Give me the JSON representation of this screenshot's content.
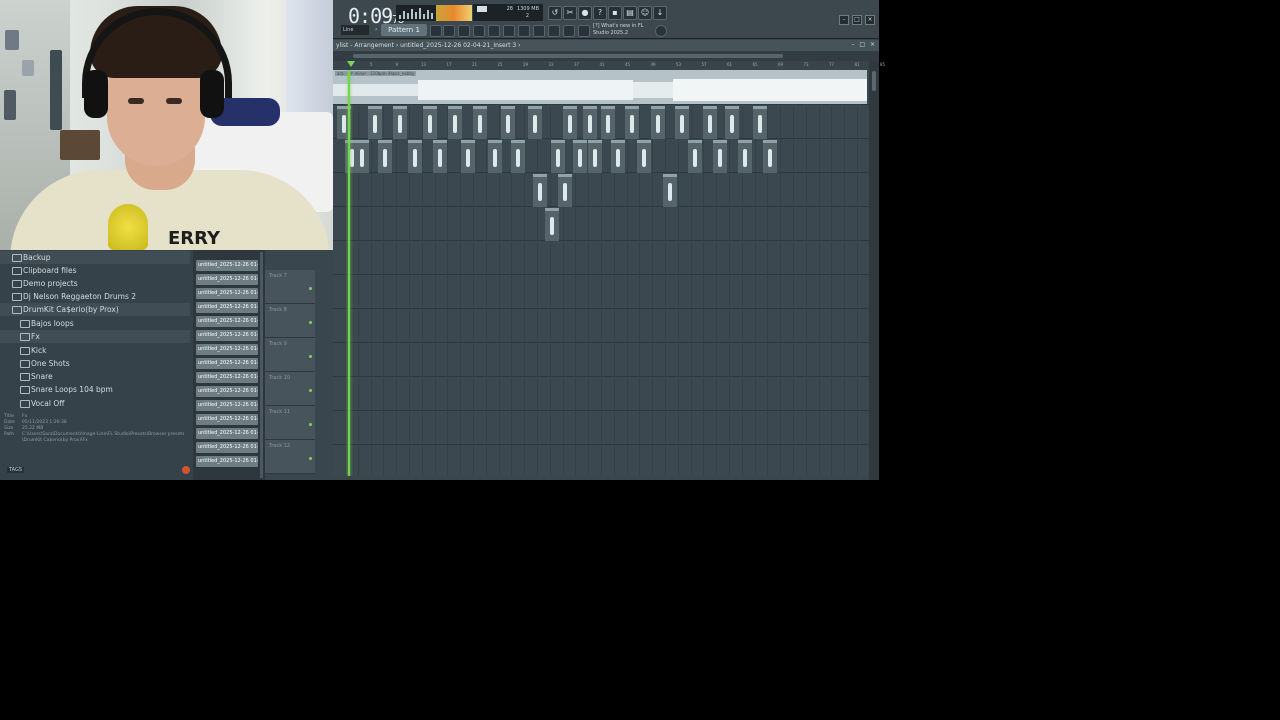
{
  "transport": {
    "time_main": "0:09",
    "time_sub": "78",
    "memory": "1309 MB",
    "cpu": "28",
    "cpu_sub": "2"
  },
  "toolbar": {
    "line_mode": "Line",
    "pattern": "Pattern 1",
    "whats_new_1": "[?] What's new in FL",
    "whats_new_2": "Studio 2025.2"
  },
  "playlist": {
    "title": "ylist - Arrangement › untitled_2025-12-26 02-04-21_Insert 3 ›",
    "ruler": [
      "5",
      "9",
      "13",
      "17",
      "21",
      "25",
      "29",
      "33",
      "37",
      "41",
      "45",
      "49",
      "53",
      "57",
      "61",
      "65",
      "69",
      "73",
      "77",
      "81",
      "85"
    ],
    "audio_label": "ara - F# minor - 110bpm ifepcc_nobby"
  },
  "browser": {
    "items": [
      "Backup",
      "Clipboard files",
      "Demo projects",
      "Dj Nelson Reggaeton Drums 2",
      "DrumKit Ca$erio(by Prox)",
      "Bajos loops",
      "Fx",
      "Kick",
      "One Shots",
      "Snare",
      "Snare Loops 104 bpm",
      "Vocal Off"
    ],
    "info": {
      "title_k": "Title",
      "title_v": "Fx",
      "date_k": "Date",
      "date_v": "05/11/2023 1:26:38",
      "size_k": "Size",
      "size_v": "25.22 MB",
      "path_k": "Path",
      "path_v": "C:\\Users\\Sara\\Documents\\Image-Line\\FL Studio\\Presets\\Browser presets",
      "path_v2": "\\DrumKit Ca$erio(by Prox)\\Fx"
    },
    "tags": "TAGS"
  },
  "channels": {
    "items": [
      "untitled_2025-12-26 01-",
      "untitled_2025-12-26 01-",
      "untitled_2025-12-26 01-",
      "untitled_2025-12-26 01-",
      "untitled_2025-12-26 01-",
      "untitled_2025-12-26 01-",
      "untitled_2025-12-26 01-",
      "untitled_2025-12-26 01-",
      "untitled_2025-12-26 01-",
      "untitled_2025-12-26 01-",
      "untitled_2025-12-26 01-",
      "untitled_2025-12-26 01-",
      "untitled_2025-12-26 01-",
      "untitled_2025-12-26 01-",
      "untitled_2025-12-26 01-"
    ]
  },
  "tracks": {
    "headers": [
      "Track 7",
      "Track 8",
      "Track 9",
      "Track 10",
      "Track 11",
      "Track 12"
    ]
  },
  "webcam": {
    "shirt_text": "ERRY"
  },
  "colors": {
    "playhead": "#76d34f",
    "clip": "#55646b",
    "panel": "#36424a"
  }
}
